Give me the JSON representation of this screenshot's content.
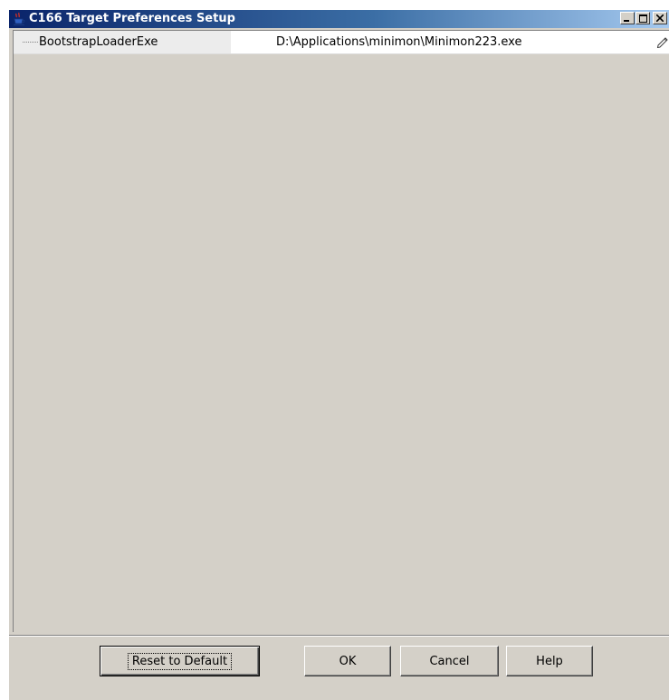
{
  "window": {
    "title": "C166 Target Preferences Setup",
    "icon": "java-coffee-cup-icon",
    "controls": {
      "minimize": "minimize-icon",
      "maximize": "maximize-icon",
      "close": "close-icon"
    }
  },
  "properties": [
    {
      "name": "BootstrapLoaderExe",
      "value": "D:\\Applications\\minimon\\Minimon223.exe",
      "edit_icon": "pencil-icon"
    }
  ],
  "buttons": {
    "reset": "Reset to Default",
    "ok": "OK",
    "cancel": "Cancel",
    "help": "Help"
  },
  "colors": {
    "titlebar_start": "#0a246a",
    "titlebar_end": "#a6caf0",
    "face": "#d4d0c8"
  }
}
